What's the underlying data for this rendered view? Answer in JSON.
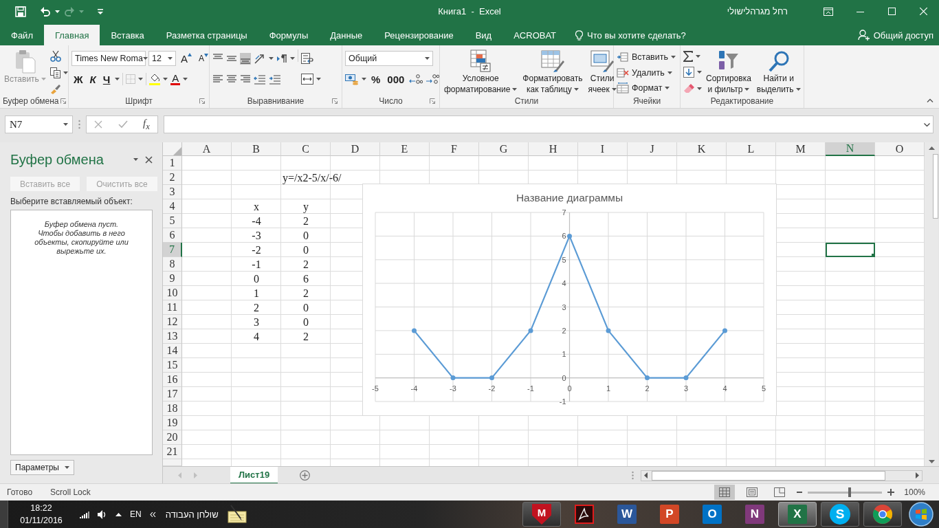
{
  "window": {
    "title": "Книга1  -  Excel",
    "user": "רחל מגרהלישולי"
  },
  "quick_access": {
    "redo": {
      "disabled": true
    }
  },
  "tabs": [
    {
      "label": "Файл",
      "selected": false
    },
    {
      "label": "Главная",
      "selected": true
    },
    {
      "label": "Вставка",
      "selected": false
    },
    {
      "label": "Разметка страницы",
      "selected": false
    },
    {
      "label": "Формулы",
      "selected": false
    },
    {
      "label": "Данные",
      "selected": false
    },
    {
      "label": "Рецензирование",
      "selected": false
    },
    {
      "label": "Вид",
      "selected": false
    },
    {
      "label": "ACROBAT",
      "selected": false
    }
  ],
  "tell_me": {
    "placeholder": "Что вы хотите сделать?"
  },
  "share": "Общий доступ",
  "ribbon": {
    "clipboard": {
      "label": "Буфер обмена",
      "paste": {
        "label": "Вставить",
        "disabled": true
      }
    },
    "font": {
      "label": "Шрифт",
      "font_name": "Times New Roma",
      "font_size": "12",
      "grow": "A",
      "shrink": "A",
      "bold": "Ж",
      "italic": "К",
      "underline": "Ч",
      "font_color": "A"
    },
    "alignment": {
      "label": "Выравнивание",
      "vertical": [
        {
          "selected": false
        },
        {
          "selected": false
        },
        {
          "selected": true
        }
      ]
    },
    "number": {
      "label": "Число",
      "format": "Общий",
      "percent": "%",
      "thousands": "000"
    },
    "styles": {
      "label": "Стили",
      "buttons": [
        {
          "lines": [
            "Условное",
            "форматирование"
          ]
        },
        {
          "lines": [
            "Форматировать",
            "как таблицу"
          ]
        },
        {
          "lines": [
            "Стили",
            "ячеек"
          ]
        }
      ]
    },
    "cells": {
      "label": "Ячейки",
      "buttons": [
        "Вставить",
        "Удалить",
        "Формат"
      ]
    },
    "editing": {
      "label": "Редактирование",
      "buttons": [
        {
          "lines": [
            "Сортировка",
            "и фильтр"
          ]
        },
        {
          "lines": [
            "Найти и",
            "выделить"
          ]
        }
      ]
    }
  },
  "formula_bar": {
    "name_box": "N7",
    "function_label": "f$_{x}$"
  },
  "task_pane": {
    "title": "Буфер обмена",
    "buttons": [
      {
        "label": "Вставить все",
        "disabled": true
      },
      {
        "label": "Очистить все",
        "disabled": true
      }
    ],
    "prompt": "Выберите вставляемый объект:",
    "messages": [
      "Буфер обмена пуст.",
      "Чтобы добавить в него объекты, скопируйте или вырежьте их."
    ],
    "options_button": "Параметры"
  },
  "sheet": {
    "columns": [
      {
        "label": "A",
        "selected": false
      },
      {
        "label": "B",
        "selected": false
      },
      {
        "label": "C",
        "selected": false
      },
      {
        "label": "D",
        "selected": false
      },
      {
        "label": "E",
        "selected": false
      },
      {
        "label": "F",
        "selected": false
      },
      {
        "label": "G",
        "selected": false
      },
      {
        "label": "H",
        "selected": false
      },
      {
        "label": "I",
        "selected": false
      },
      {
        "label": "J",
        "selected": false
      },
      {
        "label": "K",
        "selected": false
      },
      {
        "label": "L",
        "selected": false
      },
      {
        "label": "M",
        "selected": false
      },
      {
        "label": "N",
        "selected": true
      },
      {
        "label": "O",
        "selected": false
      }
    ],
    "rows": [
      {
        "label": "1",
        "selected": false
      },
      {
        "label": "2",
        "selected": false,
        "left_aligned": true,
        "cells": {
          "C": "y=/x2-5/x/-6/"
        }
      },
      {
        "label": "3",
        "selected": false
      },
      {
        "label": "4",
        "selected": false,
        "left_aligned": false,
        "cells": {
          "B": "x",
          "C": "y"
        }
      },
      {
        "label": "5",
        "selected": false,
        "left_aligned": false,
        "cells": {
          "B": "-4",
          "C": "2"
        }
      },
      {
        "label": "6",
        "selected": false,
        "left_aligned": false,
        "cells": {
          "B": "-3",
          "C": "0"
        }
      },
      {
        "label": "7",
        "selected": true,
        "left_aligned": false,
        "cells": {
          "B": "-2",
          "C": "0"
        }
      },
      {
        "label": "8",
        "selected": false,
        "left_aligned": false,
        "cells": {
          "B": "-1",
          "C": "2"
        }
      },
      {
        "label": "9",
        "selected": false,
        "left_aligned": false,
        "cells": {
          "B": "0",
          "C": "6"
        }
      },
      {
        "label": "10",
        "selected": false,
        "left_aligned": false,
        "cells": {
          "B": "1",
          "C": "2"
        }
      },
      {
        "label": "11",
        "selected": false,
        "left_aligned": false,
        "cells": {
          "B": "2",
          "C": "0"
        }
      },
      {
        "label": "12",
        "selected": false,
        "left_aligned": false,
        "cells": {
          "B": "3",
          "C": "0"
        }
      },
      {
        "label": "13",
        "selected": false,
        "left_aligned": false,
        "cells": {
          "B": "4",
          "C": "2"
        }
      },
      {
        "label": "14",
        "selected": false
      },
      {
        "label": "15",
        "selected": false
      },
      {
        "label": "16",
        "selected": false
      },
      {
        "label": "17",
        "selected": false
      },
      {
        "label": "18",
        "selected": false
      },
      {
        "label": "19",
        "selected": false
      },
      {
        "label": "20",
        "selected": false
      },
      {
        "label": "21",
        "selected": false
      }
    ]
  },
  "chart": {
    "chart_data": {
      "type": "line",
      "title": "Название диаграммы",
      "x": [
        -4,
        -3,
        -2,
        -1,
        0,
        1,
        2,
        3,
        4
      ],
      "series": [
        {
          "color": "#5b9bd5",
          "marker": "circle",
          "values": [
            2,
            0,
            0,
            2,
            6,
            2,
            0,
            0,
            2
          ]
        }
      ],
      "xlim": [
        -5,
        5
      ],
      "ylim": [
        -1,
        7
      ],
      "grid": true,
      "xticks": [
        -5,
        -4,
        -3,
        -2,
        -1,
        0,
        1,
        2,
        3,
        4,
        5
      ],
      "yticks": [
        -1,
        0,
        1,
        2,
        3,
        4,
        5,
        6,
        7
      ]
    }
  },
  "sheet_tabs": [
    {
      "label": "Лист19",
      "selected": true
    }
  ],
  "status_bar": {
    "items": [
      "Готово",
      "Scroll Lock"
    ],
    "views": [
      {
        "selected": true
      },
      {
        "selected": false
      },
      {
        "selected": false
      }
    ],
    "zoom": {
      "level": 0.56,
      "reading": "100%"
    }
  },
  "taskbar": {
    "time": "18:22",
    "date": "01/11/2016",
    "language": "EN",
    "toolbar": "שולחן העבודה",
    "apps": [
      {
        "kind": "shield",
        "letter": "M",
        "color": "#c1121f",
        "running": true,
        "selected": false
      },
      {
        "kind": "acrobat",
        "running": false,
        "selected": false
      },
      {
        "kind": "tile",
        "letter": "W",
        "color": "#2b579a",
        "running": false,
        "selected": false
      },
      {
        "kind": "tile",
        "letter": "P",
        "color": "#d24726",
        "running": false,
        "selected": false
      },
      {
        "kind": "tile",
        "letter": "O",
        "color": "#0072c6",
        "running": false,
        "selected": false
      },
      {
        "kind": "tile",
        "letter": "N",
        "color": "#80397b",
        "running": false,
        "selected": false
      },
      {
        "kind": "tile",
        "letter": "X",
        "color": "#217346",
        "running": true,
        "selected": true
      },
      {
        "kind": "round",
        "letter": "S",
        "color": "#00aff0",
        "running": true,
        "selected": false
      },
      {
        "kind": "chrome",
        "running": true,
        "selected": false
      }
    ]
  }
}
